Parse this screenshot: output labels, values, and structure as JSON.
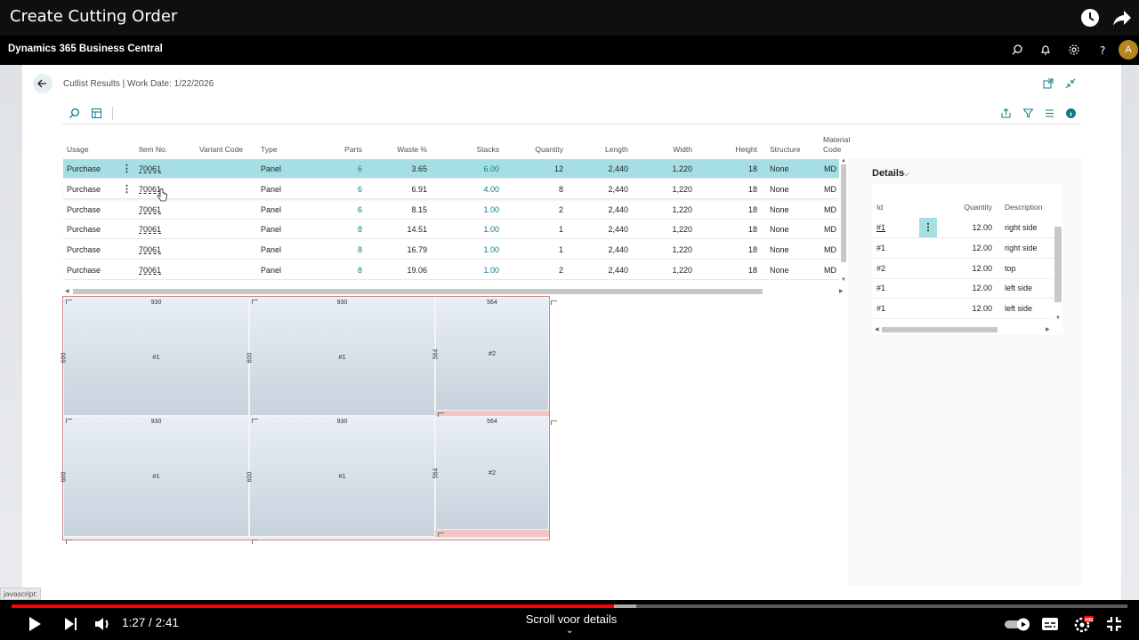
{
  "video": {
    "title": "Create Cutting Order",
    "time_current": "1:27",
    "time_separator": "/",
    "time_total": "2:41",
    "chapter": "Scroll voor details",
    "progress_fraction": 0.54,
    "buffered_fraction": 0.56,
    "accent": "#ff0000"
  },
  "app": {
    "name": "Dynamics 365 Business Central",
    "avatar_initial": "A"
  },
  "page": {
    "breadcrumb": "Cutlist Results | Work Date: 1/22/2026"
  },
  "grid": {
    "columns": {
      "usage": "Usage",
      "item_no": "Item No.",
      "variant_code": "Variant Code",
      "type": "Type",
      "parts": "Parts",
      "waste": "Waste %",
      "stacks": "Stacks",
      "quantity": "Quantity",
      "length": "Length",
      "width": "Width",
      "height": "Height",
      "structure": "Structure",
      "material_line1": "Material",
      "material_line2": "Code"
    },
    "rows": [
      {
        "usage": "Purchase",
        "item_no": "70061",
        "type": "Panel",
        "parts": "6",
        "waste": "3.65",
        "stacks": "6.00",
        "quantity": "12",
        "length": "2,440",
        "width": "1,220",
        "height": "18",
        "structure": "None",
        "material": "MD"
      },
      {
        "usage": "Purchase",
        "item_no": "70061",
        "type": "Panel",
        "parts": "6",
        "waste": "6.91",
        "stacks": "4.00",
        "quantity": "8",
        "length": "2,440",
        "width": "1,220",
        "height": "18",
        "structure": "None",
        "material": "MD"
      },
      {
        "usage": "Purchase",
        "item_no": "70061",
        "type": "Panel",
        "parts": "6",
        "waste": "8.15",
        "stacks": "1.00",
        "quantity": "2",
        "length": "2,440",
        "width": "1,220",
        "height": "18",
        "structure": "None",
        "material": "MD"
      },
      {
        "usage": "Purchase",
        "item_no": "70061",
        "type": "Panel",
        "parts": "8",
        "waste": "14.51",
        "stacks": "1.00",
        "quantity": "1",
        "length": "2,440",
        "width": "1,220",
        "height": "18",
        "structure": "None",
        "material": "MD"
      },
      {
        "usage": "Purchase",
        "item_no": "70061",
        "type": "Panel",
        "parts": "8",
        "waste": "16.79",
        "stacks": "1.00",
        "quantity": "1",
        "length": "2,440",
        "width": "1,220",
        "height": "18",
        "structure": "None",
        "material": "MD"
      },
      {
        "usage": "Purchase",
        "item_no": "70061",
        "type": "Panel",
        "parts": "8",
        "waste": "19.06",
        "stacks": "1.00",
        "quantity": "2",
        "length": "2,440",
        "width": "1,220",
        "height": "18",
        "structure": "None",
        "material": "MD"
      }
    ]
  },
  "diagram": {
    "panels": [
      {
        "width": "930",
        "height": "600",
        "id": "#1"
      },
      {
        "width": "930",
        "height": "600",
        "id": "#1"
      },
      {
        "width": "564",
        "height": "564",
        "id": "#2"
      },
      {
        "width": "930",
        "height": "600",
        "id": "#1"
      },
      {
        "width": "930",
        "height": "600",
        "id": "#1"
      },
      {
        "width": "564",
        "height": "564",
        "id": "#2"
      }
    ]
  },
  "details": {
    "title": "Details",
    "columns": {
      "id": "Id",
      "quantity": "Quantity",
      "description": "Description"
    },
    "rows": [
      {
        "id": "#1",
        "quantity": "12.00",
        "description": "right side"
      },
      {
        "id": "#1",
        "quantity": "12.00",
        "description": "right side"
      },
      {
        "id": "#2",
        "quantity": "12.00",
        "description": "top"
      },
      {
        "id": "#1",
        "quantity": "12.00",
        "description": "left side"
      },
      {
        "id": "#1",
        "quantity": "12.00",
        "description": "left side"
      }
    ]
  },
  "status_bar": {
    "text": "javascript:"
  },
  "colors": {
    "selected_row": "#a6dfe3",
    "link": "#0b7a8b",
    "waste_strip": "#f3c6c6",
    "avatar": "#b5861b"
  },
  "icons": {
    "yt_top": [
      "clock-icon",
      "share-icon"
    ],
    "bc_header": [
      "search-icon",
      "bell-icon",
      "gear-icon",
      "help-icon"
    ],
    "toolbar_left": [
      "search-icon",
      "layout-icon"
    ],
    "toolbar_right": [
      "share-icon",
      "filter-icon",
      "list-icon",
      "info-icon"
    ],
    "card": [
      "open-new-window-icon",
      "collapse-icon"
    ],
    "yt_controls": [
      "play-icon",
      "next-icon",
      "volume-icon",
      "autoplay-toggle-icon",
      "subtitles-icon",
      "settings-hd-icon",
      "exit-fullscreen-icon"
    ]
  }
}
